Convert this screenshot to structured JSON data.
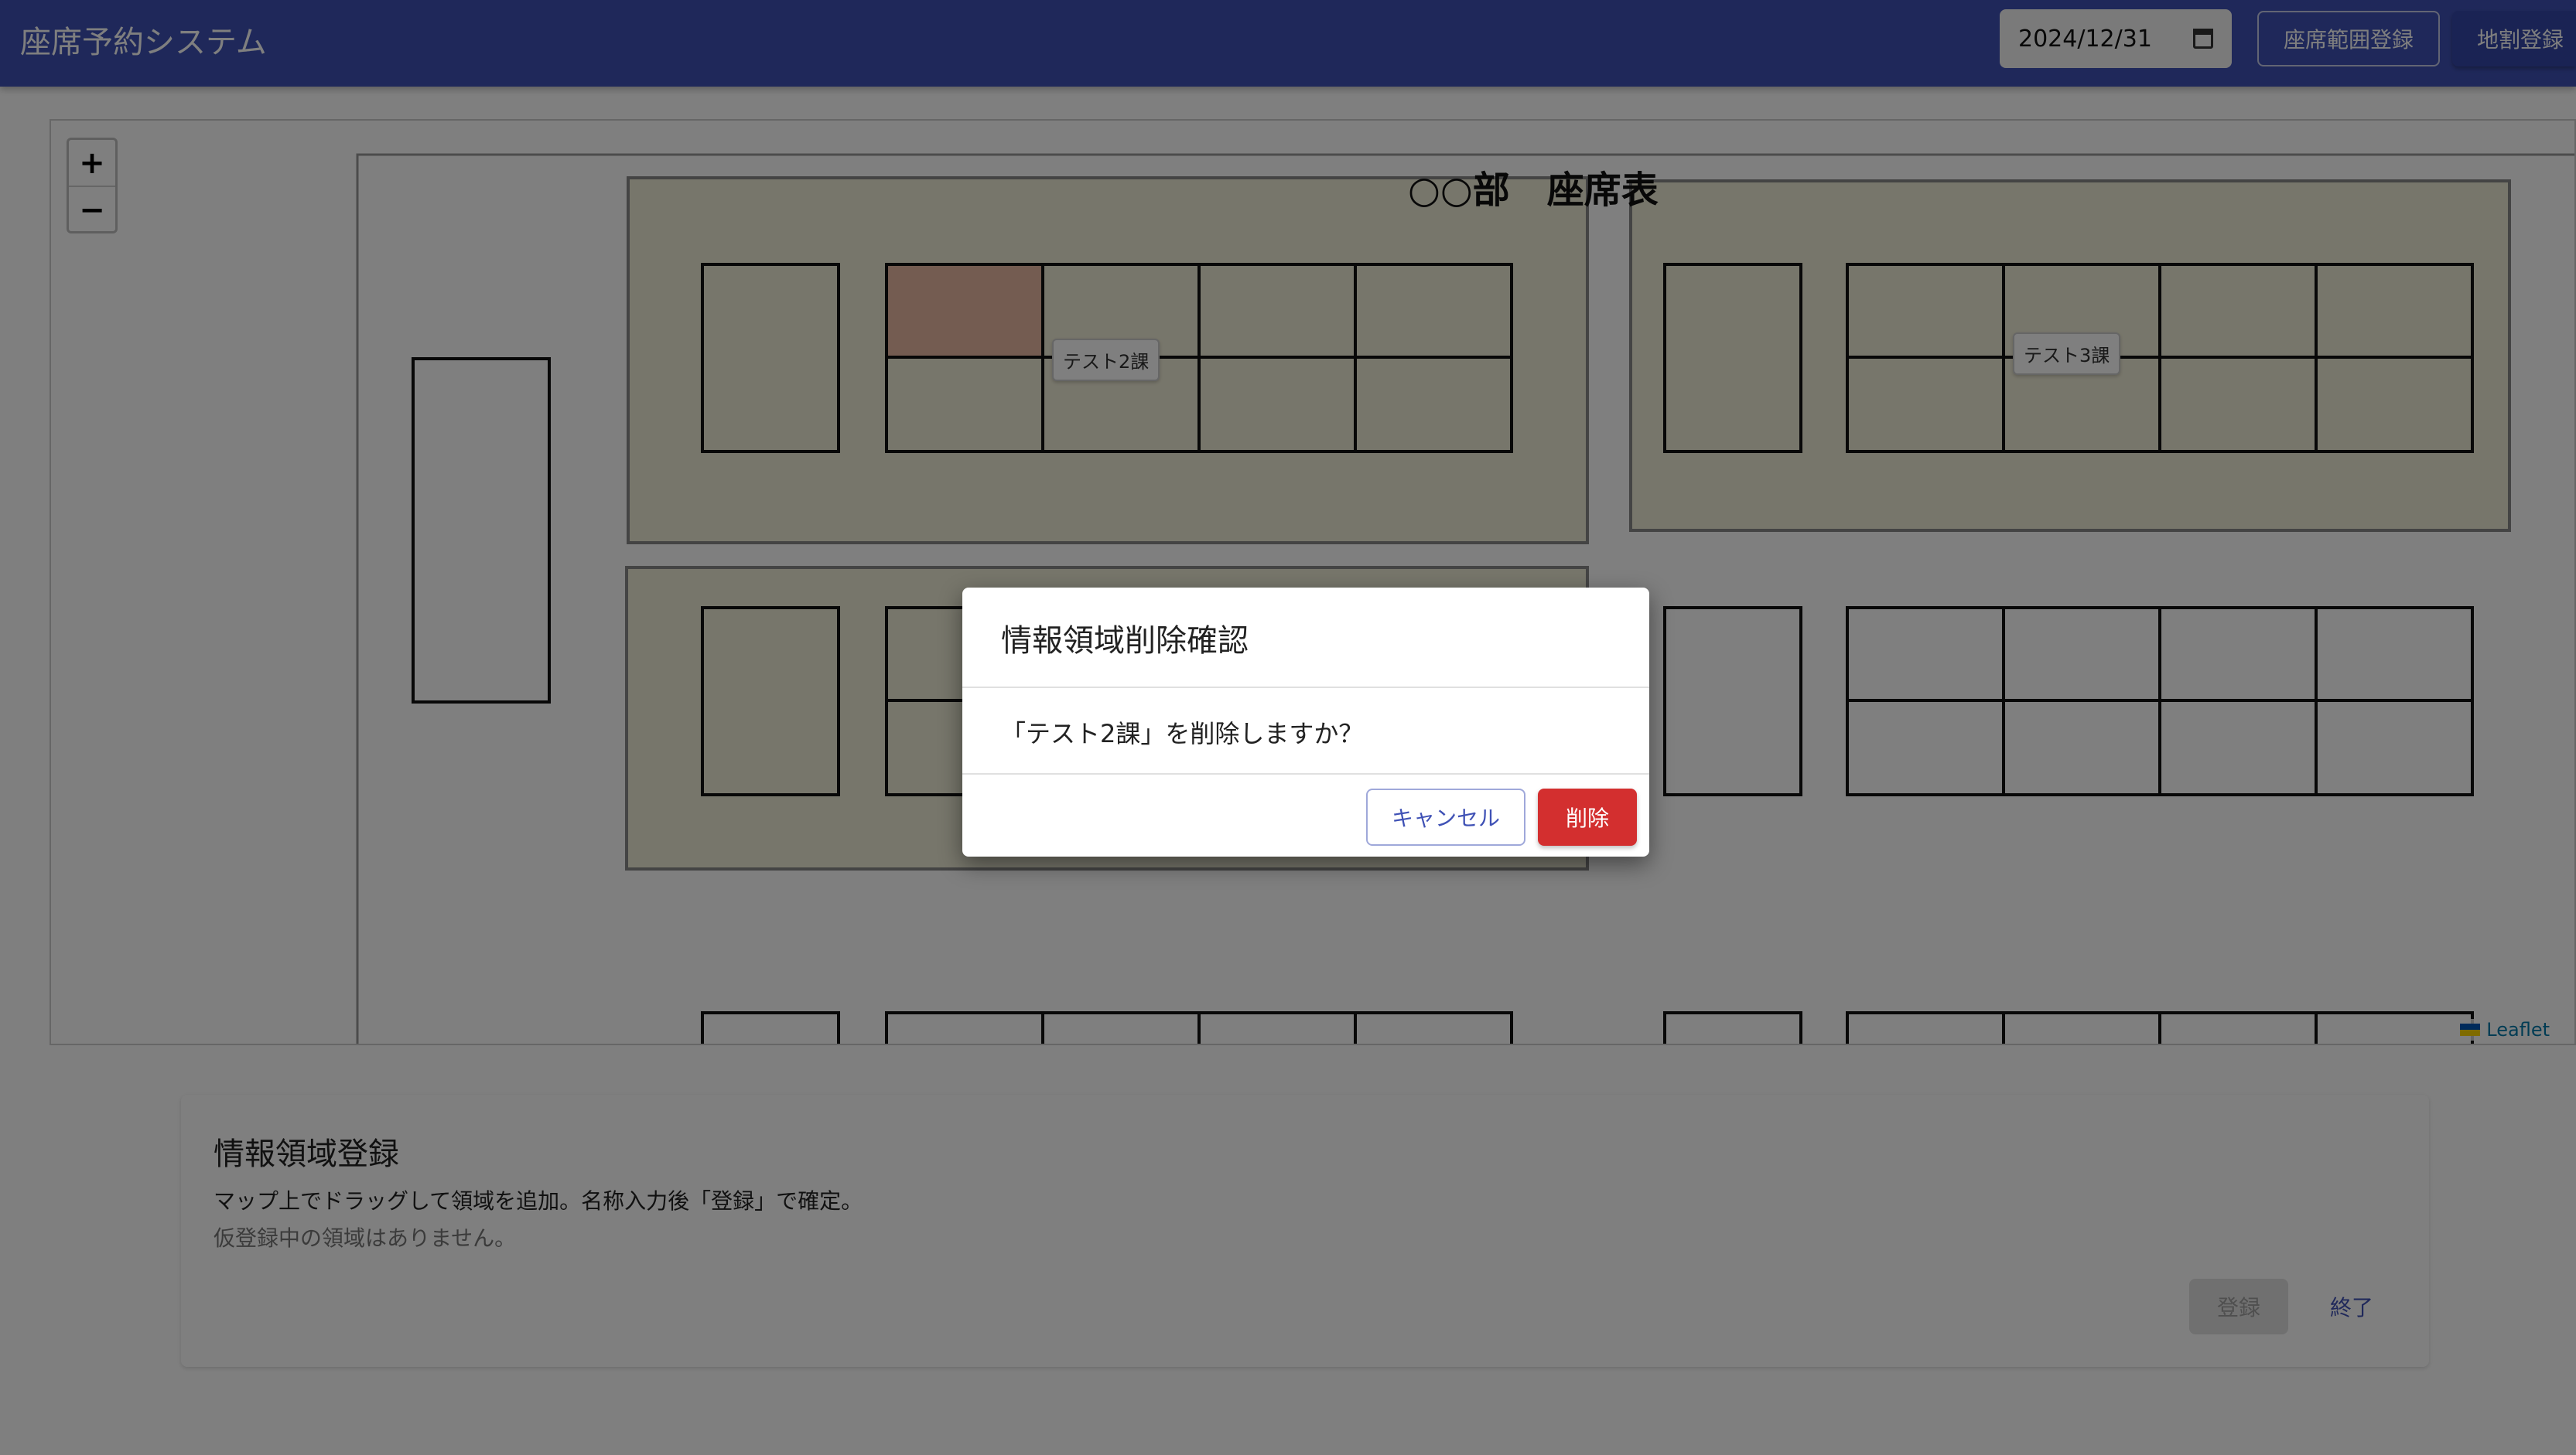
{
  "header": {
    "title": "座席予約システム",
    "date_value": "2024/12/31",
    "seat_range_button": "座席範囲登録",
    "allocation_button": "地割登録"
  },
  "map": {
    "zoom_in": "+",
    "zoom_out": "−",
    "seat_chart_title": "○○部　座席表",
    "region_labels": [
      "テスト2課",
      "テスト3課"
    ],
    "attribution": "Leaflet"
  },
  "panel": {
    "title": "情報領域登録",
    "description": "マップ上でドラッグして領域を追加。名称入力後「登録」で確定。",
    "empty_message": "仮登録中の領域はありません。",
    "register_button": "登録",
    "end_button": "終了"
  },
  "dialog": {
    "title": "情報領域削除確認",
    "message": "「テスト2課」を削除しますか？",
    "cancel_button": "キャンセル",
    "delete_button": "削除"
  },
  "colors": {
    "appbar": "#3f51b5",
    "delete": "#d32f2f",
    "region_fill": "#efecd6",
    "selected_seat": "#e8b9a3"
  }
}
